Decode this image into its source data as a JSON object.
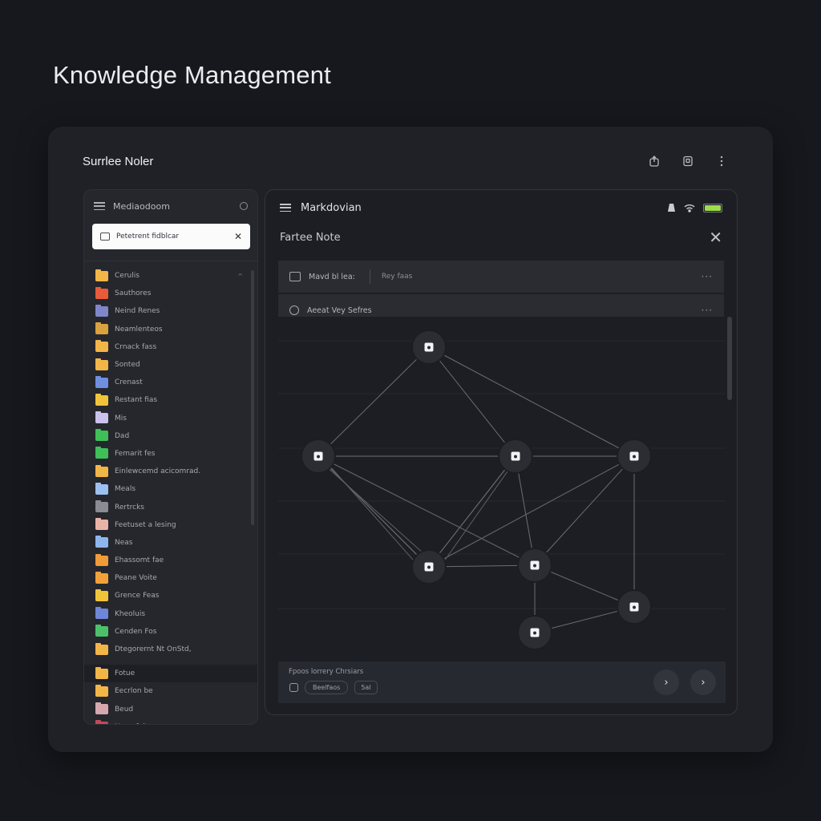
{
  "page": {
    "title": "Knowledge Management"
  },
  "window": {
    "title": "Surrlee Noler",
    "actions": [
      "share-icon",
      "copy-icon",
      "more-vertical-icon"
    ]
  },
  "sidebar": {
    "header": "Mediaodoom",
    "search": {
      "value": "Petetrent fidblcar"
    },
    "items": [
      {
        "label": "Cerulis",
        "color": "#f2b548",
        "chevron": "^"
      },
      {
        "label": "Sauthores",
        "color": "#e85b3a"
      },
      {
        "label": "Neind Renes",
        "color": "#7f86c9"
      },
      {
        "label": "Neamlenteos",
        "color": "#d9a13f"
      },
      {
        "label": "Crnack fass",
        "color": "#f2b548"
      },
      {
        "label": "Sonted",
        "color": "#f2b548"
      },
      {
        "label": "Crenast",
        "color": "#6f8fe0"
      },
      {
        "label": "Restant fias",
        "color": "#f0c43a"
      },
      {
        "label": "Mis",
        "color": "#c9c2ea"
      },
      {
        "label": "Dad",
        "color": "#3fbf58"
      },
      {
        "label": "Femarit fes",
        "color": "#3fbf58"
      },
      {
        "label": "Einlewcemd acicomrad.",
        "color": "#f2b548"
      },
      {
        "label": "Meals",
        "color": "#9cc0f0"
      },
      {
        "label": "Rertrcks",
        "color": "#8a8c93"
      },
      {
        "label": "Feetuset a lesing",
        "color": "#e8b4a8"
      },
      {
        "label": "Neas",
        "color": "#8fb6ec"
      },
      {
        "label": "Ehassomt fae",
        "color": "#f09a3a"
      },
      {
        "label": "Peane Voite",
        "color": "#f2a13a"
      },
      {
        "label": "Grence Feas",
        "color": "#f0c43a"
      },
      {
        "label": "Kheoluis",
        "color": "#6f86d8"
      },
      {
        "label": "Cenden Fos",
        "color": "#4cc16a"
      },
      {
        "label": "Dtegorernt Nt OnStd,",
        "color": "#f2b548"
      },
      {
        "label": "Fotue",
        "color": "#f2b548",
        "active": true
      },
      {
        "label": "Eecrlon be",
        "color": "#f2b548"
      },
      {
        "label": "Beud",
        "color": "#d7a7b0"
      },
      {
        "label": "Nuue fnitos",
        "color": "#c24a5a"
      }
    ]
  },
  "main": {
    "header": "Markdovian",
    "note_title": "Fartee Note",
    "rows": [
      {
        "label": "Mavd bl lea:",
        "sub": "Rey faas",
        "icon": "folder-icon"
      },
      {
        "label": "Aeeat Vey Sefres",
        "sub": "",
        "icon": "tag-icon"
      }
    ],
    "battery_level": 1.0,
    "bottom": {
      "label": "Fpoos lorrery Chrsiars",
      "chip1": "Beelfaos",
      "chip2": "5al",
      "next": "›",
      "forward": "›"
    }
  },
  "graph": {
    "nodes": [
      {
        "id": "n1"
      },
      {
        "id": "n2"
      },
      {
        "id": "n3"
      },
      {
        "id": "n4"
      },
      {
        "id": "n5"
      },
      {
        "id": "n6"
      },
      {
        "id": "n7"
      },
      {
        "id": "n8"
      }
    ],
    "edges": [
      [
        "n1",
        "n2"
      ],
      [
        "n1",
        "n3"
      ],
      [
        "n1",
        "n4"
      ],
      [
        "n2",
        "n3"
      ],
      [
        "n2",
        "n5"
      ],
      [
        "n2",
        "n6"
      ],
      [
        "n2",
        "n5b"
      ],
      [
        "n3",
        "n4"
      ],
      [
        "n3",
        "n5"
      ],
      [
        "n3",
        "n6"
      ],
      [
        "n4",
        "n5"
      ],
      [
        "n4",
        "n6"
      ],
      [
        "n4",
        "n7"
      ],
      [
        "n5",
        "n6"
      ],
      [
        "n6",
        "n7"
      ],
      [
        "n6",
        "n8"
      ],
      [
        "n7",
        "n8"
      ],
      [
        "n3",
        "n5c"
      ]
    ]
  }
}
